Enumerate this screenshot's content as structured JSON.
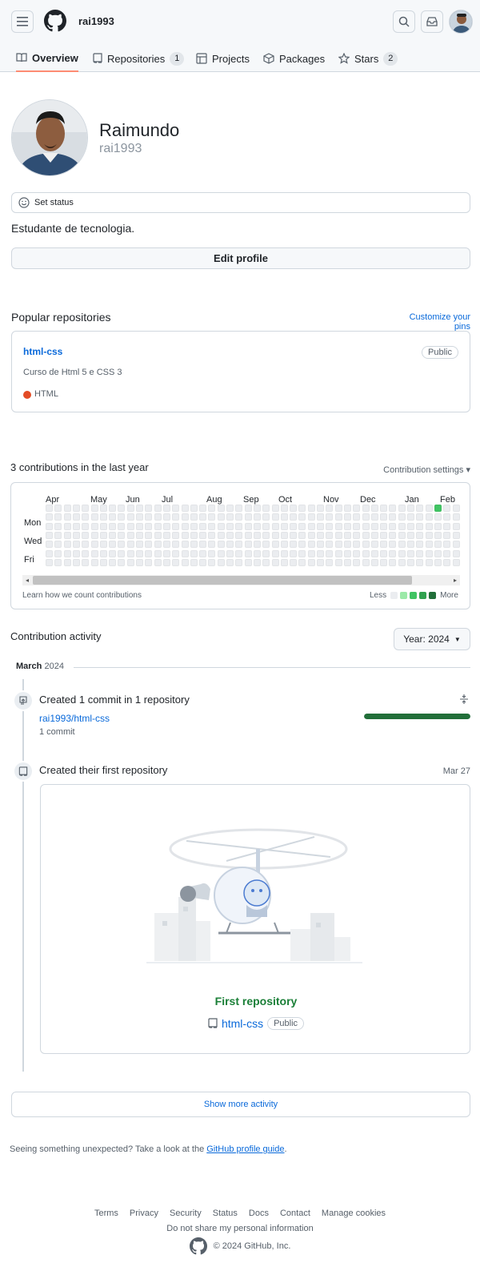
{
  "header": {
    "username": "rai1993"
  },
  "tabs": [
    {
      "label": "Overview",
      "count": ""
    },
    {
      "label": "Repositories",
      "count": "1"
    },
    {
      "label": "Projects",
      "count": ""
    },
    {
      "label": "Packages",
      "count": ""
    },
    {
      "label": "Stars",
      "count": "2"
    }
  ],
  "profile": {
    "name": "Raimundo",
    "login": "rai1993",
    "set_status": "Set status",
    "bio": "Estudante de tecnologia.",
    "edit_profile": "Edit profile"
  },
  "popular": {
    "title": "Popular repositories",
    "customize": "Customize your pins",
    "repo_name": "html-css",
    "visibility": "Public",
    "description": "Curso de Html 5 e CSS 3",
    "language": "HTML",
    "language_color": "#e34c26"
  },
  "contrib": {
    "title": "3 contributions in the last year",
    "settings": "Contribution settings ▾",
    "months": [
      "Apr",
      "May",
      "Jun",
      "Jul",
      "Aug",
      "Sep",
      "Oct",
      "Nov",
      "Dec",
      "Jan",
      "Feb"
    ],
    "days": [
      "Mon",
      "Wed",
      "Fri"
    ],
    "learn": "Learn how we count contributions",
    "less": "Less",
    "more": "More",
    "legend_colors": [
      "#ebedf0",
      "#9be9a8",
      "#40c463",
      "#30a14e",
      "#216e39"
    ]
  },
  "activity": {
    "title": "Contribution activity",
    "year_button": "Year: 2024",
    "month_label": "March",
    "month_year": "2024",
    "commit_title": "Created 1 commit in 1 repository",
    "commit_repo": "rai1993/html-css",
    "commit_count": "1 commit",
    "commit_share": 1.0,
    "first_repo_title": "Created their first repository",
    "first_repo_date": "Mar 27",
    "first_repo_label": "First repository",
    "first_repo_name": "html-css",
    "first_repo_visibility": "Public",
    "show_more": "Show more activity"
  },
  "guide": {
    "text": "Seeing something unexpected? Take a look at the ",
    "link": "GitHub profile guide",
    "end": "."
  },
  "footer": {
    "links": [
      "Terms",
      "Privacy",
      "Security",
      "Status",
      "Docs",
      "Contact",
      "Manage cookies"
    ],
    "do_not_share": "Do not share my personal information",
    "copyright": "© 2024 GitHub, Inc."
  }
}
